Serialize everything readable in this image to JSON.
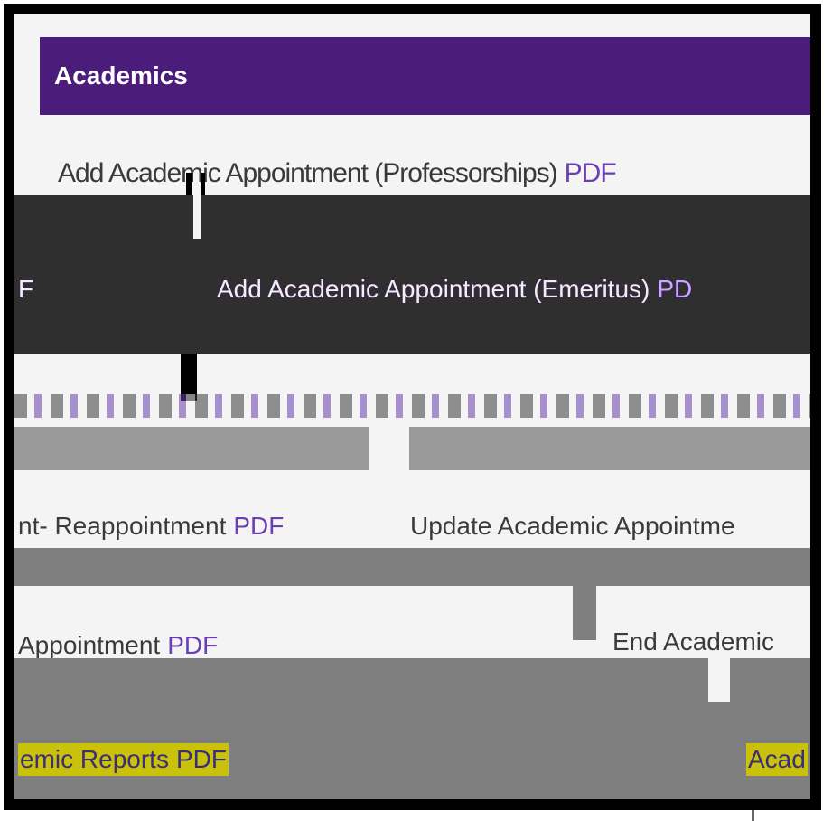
{
  "panel": {
    "title": "Academics"
  },
  "links": [
    {
      "label": "Add Academic Appointment (Professorships)",
      "pdf": "PDF"
    },
    {
      "label": "Add Academic Appointment (Emeritus)",
      "pdf": "PD"
    },
    {
      "label": "nt- Reappointment",
      "pdf": "PDF"
    },
    {
      "label": "Update Academic Appointme",
      "pdf": ""
    },
    {
      "label": "Appointment",
      "pdf": "PDF"
    },
    {
      "label": "End Academic",
      "pdf": ""
    },
    {
      "label": "emic Reports",
      "pdf": "PDF"
    },
    {
      "label": "Acad",
      "pdf": ""
    }
  ],
  "fragments": {
    "left_f": "F"
  },
  "colors": {
    "header_bg": "#4b1c7a",
    "link_pdf": "#6a3fb0",
    "highlight": "#c9c10a"
  }
}
